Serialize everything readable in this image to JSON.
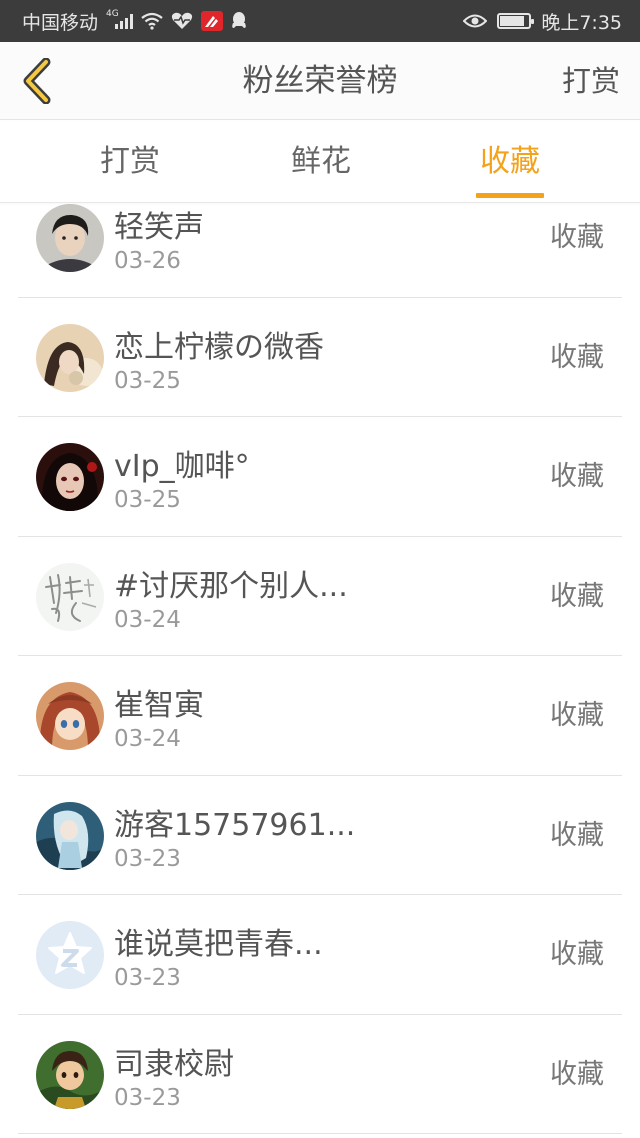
{
  "status_bar": {
    "carrier": "中国移动",
    "network": "4G",
    "time": "晚上7:35",
    "battery_level": 0.85
  },
  "nav": {
    "title": "粉丝荣誉榜",
    "right_action": "打赏"
  },
  "tabs": [
    {
      "label": "打赏",
      "active": false
    },
    {
      "label": "鲜花",
      "active": false
    },
    {
      "label": "收藏",
      "active": true
    }
  ],
  "accent_color": "#f5a21b",
  "list": [
    {
      "name": "轻笑声",
      "date": "03-26",
      "action": "收藏",
      "avatar": "photo-boy-avatar"
    },
    {
      "name": "恋上柠檬の微香",
      "date": "03-25",
      "action": "收藏",
      "avatar": "photo-girl-avatar"
    },
    {
      "name": "vIp_咖啡°",
      "date": "03-25",
      "action": "收藏",
      "avatar": "art-girl-avatar"
    },
    {
      "name": "#讨厌那个别人...",
      "date": "03-24",
      "action": "收藏",
      "avatar": "calligraphy-avatar"
    },
    {
      "name": "崔智寅",
      "date": "03-24",
      "action": "收藏",
      "avatar": "anime-girl-avatar"
    },
    {
      "name": "游客15757961...",
      "date": "03-23",
      "action": "收藏",
      "avatar": "anime-boy-avatar"
    },
    {
      "name": "谁说莫把青春...",
      "date": "03-23",
      "action": "收藏",
      "avatar": "default-z-avatar"
    },
    {
      "name": "司隶校尉",
      "date": "03-23",
      "action": "收藏",
      "avatar": "cartoon-warrior-avatar"
    }
  ]
}
